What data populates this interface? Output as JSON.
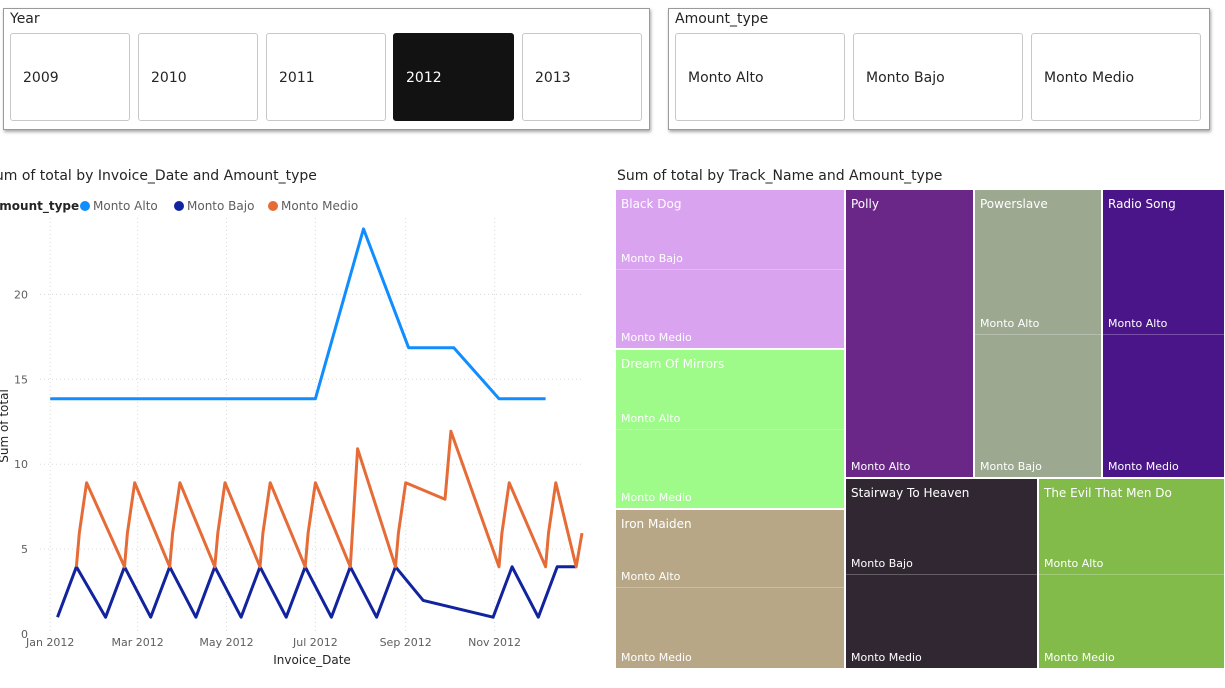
{
  "year_slicer": {
    "header": "Year",
    "options": [
      {
        "label": "2009",
        "selected": false
      },
      {
        "label": "2010",
        "selected": false
      },
      {
        "label": "2011",
        "selected": false
      },
      {
        "label": "2012",
        "selected": true
      },
      {
        "label": "2013",
        "selected": false
      }
    ]
  },
  "amount_slicer": {
    "header": "Amount_type",
    "options": [
      {
        "label": "Monto Alto",
        "selected": false
      },
      {
        "label": "Monto Bajo",
        "selected": false
      },
      {
        "label": "Monto Medio",
        "selected": false
      }
    ]
  },
  "line_chart": {
    "title": "Sum of total by Invoice_Date and Amount_type",
    "legend_label": "Amount_type",
    "xlabel": "Invoice_Date",
    "ylabel": "Sum of total"
  },
  "treemap": {
    "title": "Sum of total by Track_Name and Amount_type",
    "tracks": [
      {
        "name": "Black Dog",
        "color": "#d9a3f0",
        "segments": [
          "Monto Bajo",
          "Monto Medio"
        ]
      },
      {
        "name": "Dream Of Mirrors",
        "color": "#9efb8a",
        "segments": [
          "Monto Alto",
          "Monto Medio"
        ]
      },
      {
        "name": "Iron Maiden",
        "color": "#b7a786",
        "segments": [
          "Monto Alto",
          "Monto Medio"
        ]
      },
      {
        "name": "Polly",
        "color": "#6a2787",
        "segments": [
          "Monto Alto"
        ]
      },
      {
        "name": "Powerslave",
        "color": "#9ca890",
        "segments": [
          "Monto Alto",
          "Monto Bajo"
        ]
      },
      {
        "name": "Radio Song",
        "color": "#4a1588",
        "segments": [
          "Monto Alto",
          "Monto Medio"
        ]
      },
      {
        "name": "Stairway To Heaven",
        "color": "#302733",
        "segments": [
          "Monto Bajo",
          "Monto Medio"
        ]
      },
      {
        "name": "The Evil That Men Do",
        "color": "#82bb4a",
        "segments": [
          "Monto Alto",
          "Monto Medio"
        ]
      }
    ]
  },
  "chart_data": [
    {
      "type": "line",
      "title": "Sum of total by Invoice_Date and Amount_type",
      "xlabel": "Invoice_Date",
      "ylabel": "Sum of total",
      "x_ticks": [
        "2012-01-01",
        "2012-03-01",
        "2012-05-01",
        "2012-07-01",
        "2012-09-01",
        "2012-11-01"
      ],
      "x_tick_labels": [
        "Jan 2012",
        "Mar 2012",
        "May 2012",
        "Jul 2012",
        "Sep 2012",
        "Nov 2012"
      ],
      "y_ticks": [
        0,
        5,
        10,
        15,
        20
      ],
      "xlim": [
        "2011-12-25",
        "2012-12-31"
      ],
      "ylim": [
        0,
        24.5
      ],
      "grid": true,
      "legend": "top-left",
      "series": [
        {
          "name": "Monto Alto",
          "color": "#118dff",
          "points": [
            [
              "2012-01-01",
              13.86
            ],
            [
              "2012-07-01",
              13.86
            ],
            [
              "2012-08-03",
              23.86
            ],
            [
              "2012-09-03",
              16.86
            ],
            [
              "2012-10-04",
              16.86
            ],
            [
              "2012-11-04",
              13.86
            ],
            [
              "2012-12-06",
              13.86
            ]
          ]
        },
        {
          "name": "Monto Bajo",
          "color": "#12239e",
          "points": [
            [
              "2012-01-06",
              0.99
            ],
            [
              "2012-01-19",
              3.96
            ],
            [
              "2012-02-08",
              0.99
            ],
            [
              "2012-02-21",
              3.96
            ],
            [
              "2012-03-10",
              0.99
            ],
            [
              "2012-03-23",
              3.96
            ],
            [
              "2012-04-10",
              0.99
            ],
            [
              "2012-04-23",
              3.96
            ],
            [
              "2012-05-11",
              0.99
            ],
            [
              "2012-05-24",
              3.96
            ],
            [
              "2012-06-11",
              0.99
            ],
            [
              "2012-06-24",
              3.96
            ],
            [
              "2012-07-12",
              0.99
            ],
            [
              "2012-07-25",
              3.96
            ],
            [
              "2012-08-12",
              0.99
            ],
            [
              "2012-08-25",
              3.96
            ],
            [
              "2012-09-13",
              1.98
            ],
            [
              "2012-10-31",
              0.99
            ],
            [
              "2012-11-13",
              3.96
            ],
            [
              "2012-12-01",
              0.99
            ],
            [
              "2012-12-14",
              3.96
            ],
            [
              "2012-12-27",
              3.96
            ]
          ]
        },
        {
          "name": "Monto Medio",
          "color": "#e66c37",
          "points": [
            [
              "2012-01-19",
              3.96
            ],
            [
              "2012-01-21",
              5.94
            ],
            [
              "2012-01-26",
              8.91
            ],
            [
              "2012-02-21",
              3.96
            ],
            [
              "2012-02-23",
              5.94
            ],
            [
              "2012-02-28",
              8.91
            ],
            [
              "2012-03-23",
              3.96
            ],
            [
              "2012-03-25",
              5.94
            ],
            [
              "2012-03-30",
              8.91
            ],
            [
              "2012-04-23",
              3.96
            ],
            [
              "2012-04-25",
              5.94
            ],
            [
              "2012-04-30",
              8.91
            ],
            [
              "2012-05-24",
              3.96
            ],
            [
              "2012-05-26",
              5.94
            ],
            [
              "2012-05-31",
              8.91
            ],
            [
              "2012-06-24",
              3.96
            ],
            [
              "2012-06-26",
              5.94
            ],
            [
              "2012-07-01",
              8.91
            ],
            [
              "2012-07-25",
              3.96
            ],
            [
              "2012-07-30",
              10.91
            ],
            [
              "2012-08-25",
              3.96
            ],
            [
              "2012-08-27",
              5.94
            ],
            [
              "2012-09-01",
              8.91
            ],
            [
              "2012-09-28",
              7.94
            ],
            [
              "2012-10-02",
              11.94
            ],
            [
              "2012-11-04",
              3.96
            ],
            [
              "2012-11-06",
              5.94
            ],
            [
              "2012-11-11",
              8.91
            ],
            [
              "2012-12-06",
              3.96
            ],
            [
              "2012-12-08",
              5.94
            ],
            [
              "2012-12-13",
              8.91
            ],
            [
              "2012-12-27",
              3.96
            ],
            [
              "2012-12-31",
              5.94
            ]
          ]
        }
      ]
    },
    {
      "type": "treemap",
      "title": "Sum of total by Track_Name and Amount_type",
      "groups": [
        {
          "name": "Black Dog",
          "values": {
            "Monto Bajo": 50,
            "Monto Medio": 50
          }
        },
        {
          "name": "Dream Of Mirrors",
          "values": {
            "Monto Alto": 50,
            "Monto Medio": 50
          }
        },
        {
          "name": "Iron Maiden",
          "values": {
            "Monto Alto": 49,
            "Monto Medio": 51
          }
        },
        {
          "name": "Polly",
          "values": {
            "Monto Alto": 120
          }
        },
        {
          "name": "Powerslave",
          "values": {
            "Monto Alto": 55,
            "Monto Bajo": 65
          }
        },
        {
          "name": "Radio Song",
          "values": {
            "Monto Alto": 55,
            "Monto Medio": 65
          }
        },
        {
          "name": "Stairway To Heaven",
          "values": {
            "Monto Bajo": 50,
            "Monto Medio": 50
          }
        },
        {
          "name": "The Evil That Men Do",
          "values": {
            "Monto Alto": 50,
            "Monto Medio": 50
          }
        }
      ]
    }
  ]
}
